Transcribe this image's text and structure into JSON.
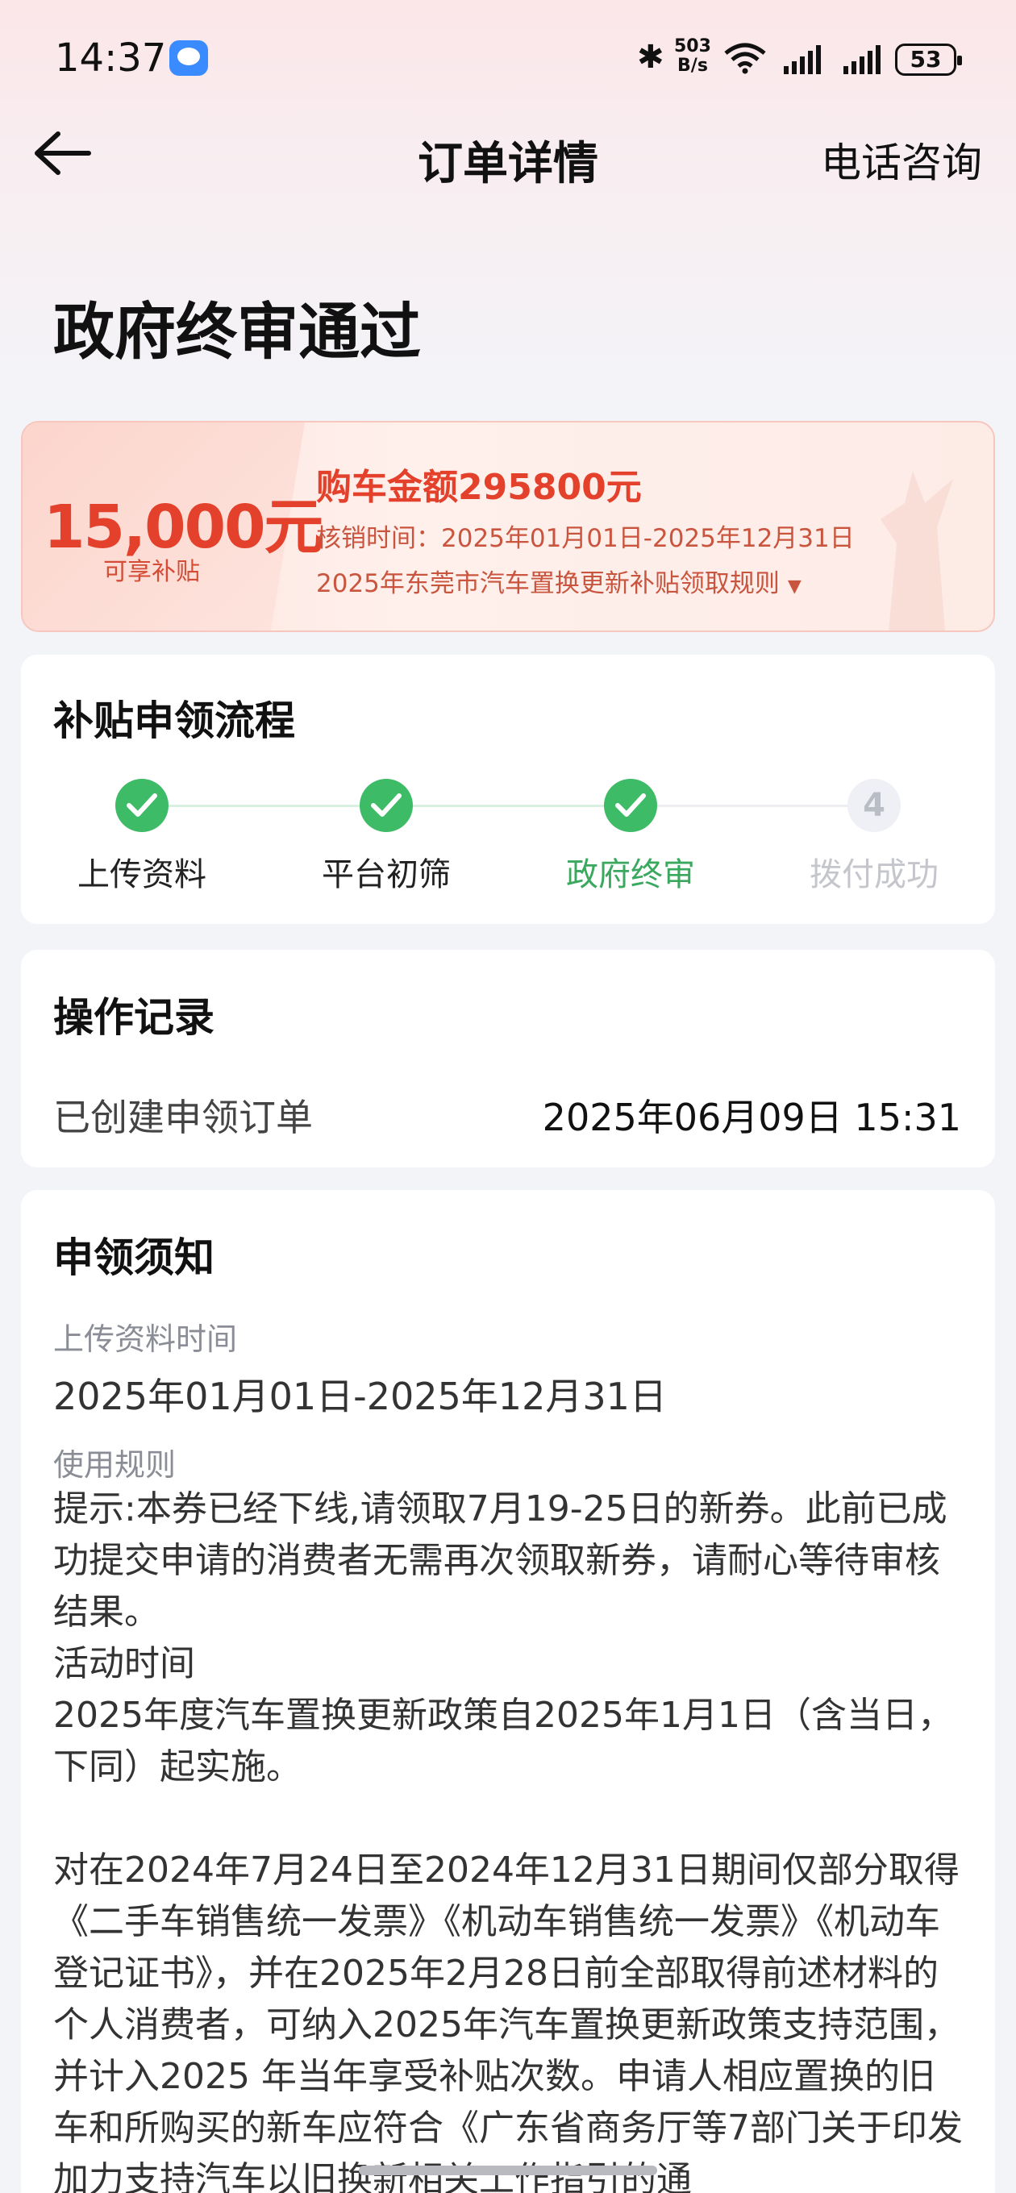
{
  "status_bar": {
    "time": "14:37",
    "speed_top": "503",
    "speed_bottom": "B/s",
    "battery": "53"
  },
  "nav": {
    "title": "订单详情",
    "action": "电话咨询"
  },
  "status_title": "政府终审通过",
  "subsidy": {
    "amount": "15,000元",
    "amount_label": "可享补贴",
    "purchase": "购车金额295800元",
    "writeoff": "核销时间：2025年01月01日-2025年12月31日",
    "rules_link": "2025年东莞市汽车置换更新补贴领取规则"
  },
  "process": {
    "title": "补贴申领流程",
    "steps": [
      {
        "label": "上传资料",
        "state": "done"
      },
      {
        "label": "平台初筛",
        "state": "done"
      },
      {
        "label": "政府终审",
        "state": "active"
      },
      {
        "label": "拨付成功",
        "state": "pending",
        "number": "4"
      }
    ]
  },
  "records": {
    "title": "操作记录",
    "items": [
      {
        "label": "已创建申领订单",
        "time": "2025年06月09日 15:31"
      }
    ]
  },
  "notice": {
    "title": "申领须知",
    "upload_time_label": "上传资料时间",
    "upload_time_value": "2025年01月01日-2025年12月31日",
    "rules_label": "使用规则",
    "rules_text": "提示:本券已经下线,请领取7月19-25日的新券。此前已成功提交申请的消费者无需再次领取新券，请耐心等待审核结果。\n活动时间\n2025年度汽车置换更新政策自2025年1月1日（含当日，下同）起实施。\n\n对在2024年7月24日至2024年12月31日期间仅部分取得《二手车销售统一发票》《机动车销售统一发票》《机动车登记证书》，并在2025年2月28日前全部取得前述材料的个人消费者，可纳入2025年汽车置换更新政策支持范围，并计入2025 年当年享受补贴次数。申请人相应置换的旧车和所购买的新车应符合《广东省商务厅等7部门关于印发加力支持汽车以旧换新相关工作指引的通"
  },
  "colors": {
    "success": "#3dbb66",
    "accent_red": "#e4412c",
    "pending": "#c4c6cc"
  }
}
